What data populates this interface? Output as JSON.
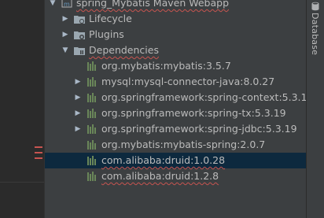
{
  "project": {
    "name": "spring_Mybatis Maven Webapp"
  },
  "tree": {
    "nodes": [
      {
        "label": "Lifecycle",
        "kind": "lifecycle",
        "expanded": false,
        "underline": false
      },
      {
        "label": "Plugins",
        "kind": "plugins",
        "expanded": false,
        "underline": false
      },
      {
        "label": "Dependencies",
        "kind": "dependencies",
        "expanded": true,
        "underline": true
      }
    ],
    "dependencies": [
      {
        "label": "org.mybatis:mybatis:3.5.7",
        "has_children": false,
        "underline": false,
        "selected": false
      },
      {
        "label": "mysql:mysql-connector-java:8.0.27",
        "has_children": true,
        "underline": false,
        "selected": false
      },
      {
        "label": "org.springframework:spring-context:5.3.13",
        "has_children": true,
        "underline": false,
        "selected": false
      },
      {
        "label": "org.springframework:spring-tx:5.3.19",
        "has_children": true,
        "underline": false,
        "selected": false
      },
      {
        "label": "org.springframework:spring-jdbc:5.3.19",
        "has_children": true,
        "underline": false,
        "selected": false
      },
      {
        "label": "org.mybatis:mybatis-spring:2.0.7",
        "has_children": false,
        "underline": false,
        "selected": false
      },
      {
        "label": "com.alibaba:druid:1.0.28",
        "has_children": false,
        "underline": true,
        "selected": true
      },
      {
        "label": "com.alibaba:druid:1.2.8",
        "has_children": false,
        "underline": true,
        "selected": false
      }
    ]
  },
  "sidebar": {
    "tab_label": "Database"
  },
  "colors": {
    "background": "#3c3f41",
    "selection": "#0d293e",
    "text": "#bbbbbb",
    "error_underline": "#c75450",
    "dependency_icon": "#6a8759"
  }
}
